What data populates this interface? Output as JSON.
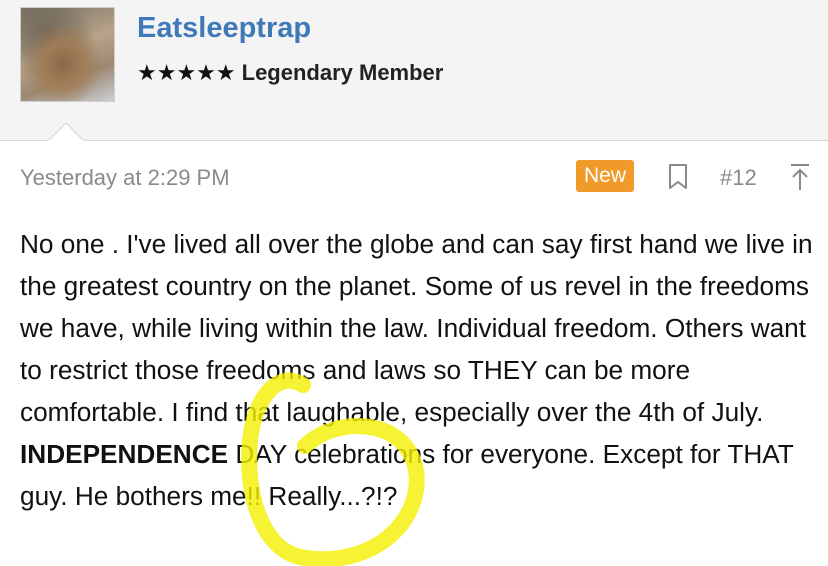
{
  "user": {
    "name": "Eatsleeptrap",
    "stars": "★★★★★",
    "rank": "Legendary Member"
  },
  "post": {
    "timestamp": "Yesterday at 2:29 PM",
    "new_badge": "New",
    "number": "#12",
    "body_part1": "No one . I've lived all over the globe and can say first hand we live in the greatest country on the planet. Some of us revel in the freedoms we have, while living within the law. Individual freedom. Others want to restrict those freedoms and laws so THEY can be more comfortable. I find that laughable, especially over the 4th of July. ",
    "body_bold": "INDEPENDENCE",
    "body_part2": " DAY celebrations for everyone. Except for THAT guy. He bothers me!! Really...?!?"
  },
  "icons": {
    "bookmark": "bookmark-icon",
    "scroll_top": "arrow-up-to-line-icon"
  },
  "colors": {
    "username": "#3f79b8",
    "new_badge_bg": "#f09a2a",
    "meta_text": "#8a8a8a",
    "header_bg": "#f4f4f4",
    "highlight_annotation": "#f2f000"
  }
}
